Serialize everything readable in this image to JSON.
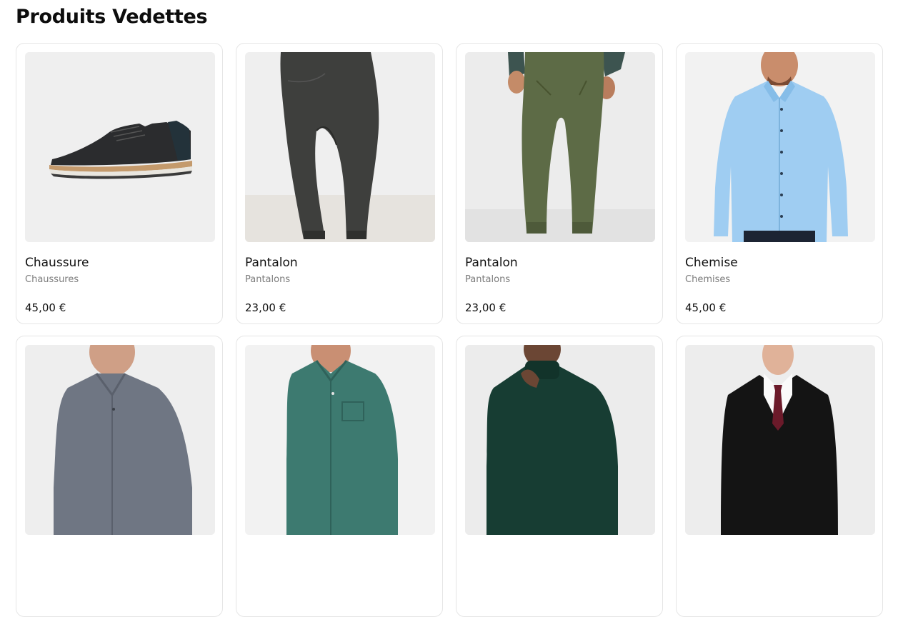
{
  "section": {
    "title": "Produits Vedettes"
  },
  "products": [
    {
      "name": "Chaussure",
      "category": "Chaussures",
      "price": "45,00 €",
      "image_icon": "shoe-image"
    },
    {
      "name": "Pantalon",
      "category": "Pantalons",
      "price": "23,00 €",
      "image_icon": "dark-pants-image"
    },
    {
      "name": "Pantalon",
      "category": "Pantalons",
      "price": "23,00 €",
      "image_icon": "green-pants-image"
    },
    {
      "name": "Chemise",
      "category": "Chemises",
      "price": "45,00 €",
      "image_icon": "blue-shirt-image"
    },
    {
      "image_icon": "grey-shirt-image"
    },
    {
      "image_icon": "teal-shirt-image"
    },
    {
      "image_icon": "green-sweater-image"
    },
    {
      "image_icon": "black-suit-image"
    }
  ],
  "colors": {
    "card_border": "#e5e5e5",
    "image_bg": "#efefef",
    "category_text": "#7b7b7b"
  }
}
